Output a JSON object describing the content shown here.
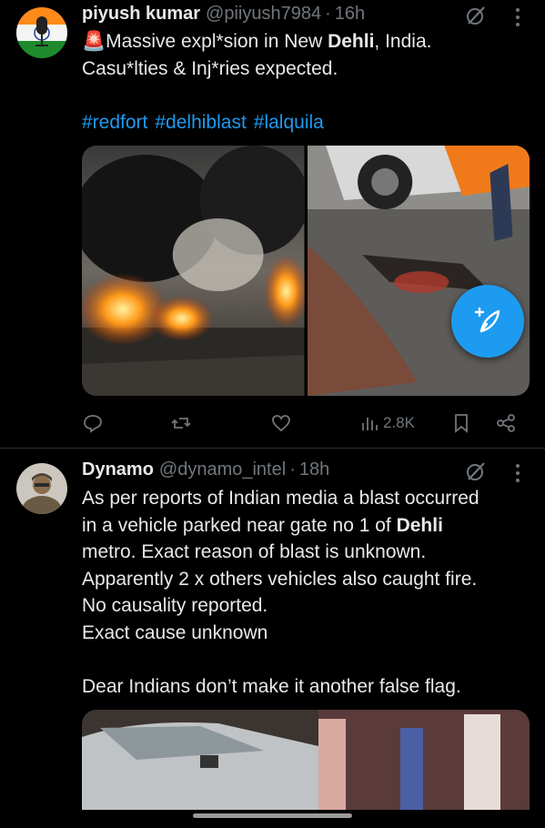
{
  "tweets": [
    {
      "author_name": "piyush kumar",
      "handle": "@piiyush7984",
      "separator": "·",
      "time": "16h",
      "text_lines": [
        {
          "prefix": "🚨Massive expl*sion in New ",
          "bold": "Dehli",
          "suffix": ", India."
        },
        {
          "prefix": "Casu*lties & Inj*ries expected.",
          "bold": "",
          "suffix": ""
        }
      ],
      "hashtags": [
        "#redfort",
        "#delhiblast",
        "#lalquila"
      ],
      "views": "2.8K"
    },
    {
      "author_name": "Dynamo",
      "handle": "@dynamo_intel",
      "separator": "·",
      "time": "18h",
      "text_lines": [
        {
          "prefix": "As per reports of Indian media a blast occurred",
          "bold": "",
          "suffix": ""
        },
        {
          "prefix": "in a vehicle parked near gate no 1 of ",
          "bold": "Dehli",
          "suffix": ""
        },
        {
          "prefix": "metro. Exact reason of blast is unknown.",
          "bold": "",
          "suffix": ""
        },
        {
          "prefix": "Apparently 2 x others vehicles also caught fire.",
          "bold": "",
          "suffix": ""
        },
        {
          "prefix": "No causality reported.",
          "bold": "",
          "suffix": ""
        },
        {
          "prefix": "Exact cause unknown",
          "bold": "",
          "suffix": ""
        },
        {
          "prefix": "",
          "bold": "",
          "suffix": ""
        },
        {
          "prefix": "Dear Indians don’t make it another false flag.",
          "bold": "",
          "suffix": ""
        }
      ]
    }
  ],
  "colors": {
    "accent": "#1d9bf0",
    "muted": "#71767b",
    "text": "#e7e9ea",
    "divider": "#2f3336"
  },
  "icons": [
    "grok-icon",
    "more-icon",
    "reply-icon",
    "retweet-icon",
    "like-icon",
    "views-icon",
    "bookmark-icon",
    "share-icon",
    "compose-icon"
  ]
}
